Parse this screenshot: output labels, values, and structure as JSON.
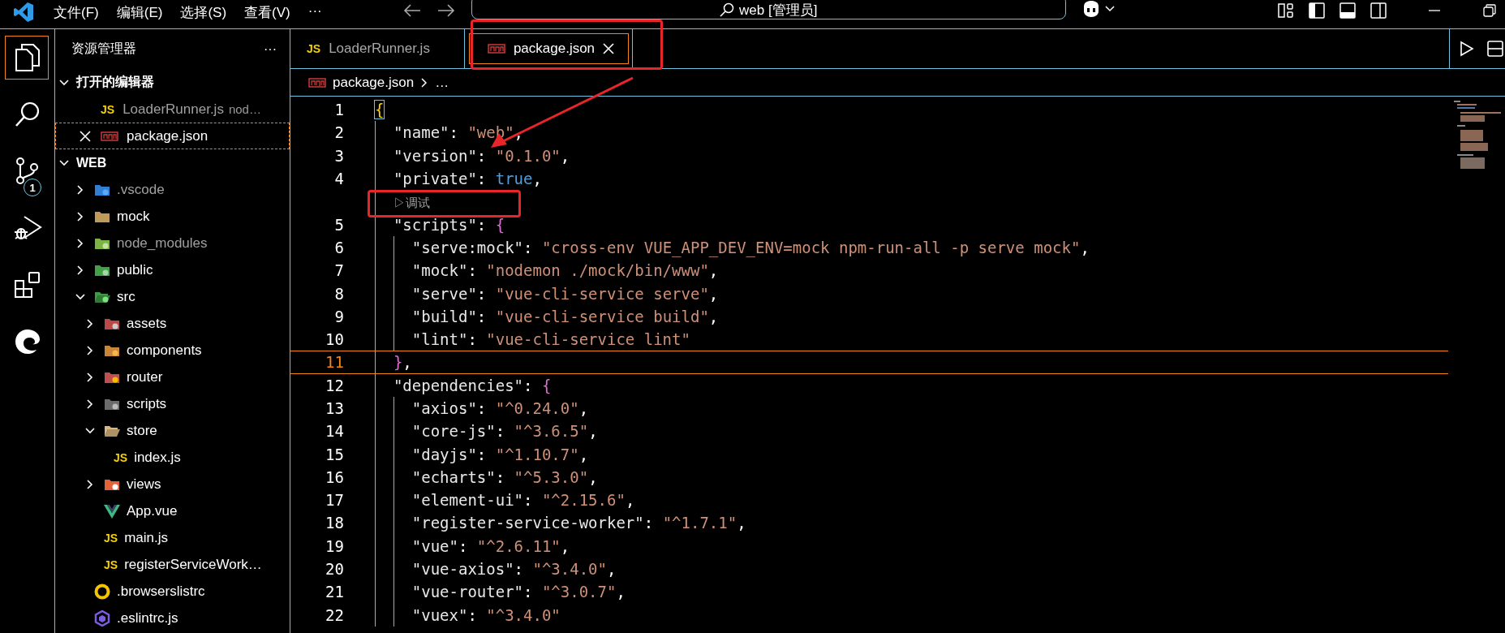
{
  "title_bar": {
    "menus": [
      {
        "label": "文件(F)"
      },
      {
        "label": "编辑(E)"
      },
      {
        "label": "选择(S)"
      },
      {
        "label": "查看(V)"
      }
    ],
    "more": "···",
    "command_center": "web [管理员]"
  },
  "activity_bar": [
    {
      "kind": "explorer",
      "selected": true
    },
    {
      "kind": "search",
      "selected": false
    },
    {
      "kind": "scm",
      "selected": false,
      "badge": "1"
    },
    {
      "kind": "debug",
      "selected": false
    },
    {
      "kind": "extensions",
      "selected": false
    },
    {
      "kind": "browser",
      "selected": false
    }
  ],
  "explorer": {
    "title": "资源管理器",
    "more": "···",
    "open_editors": {
      "title": "打开的编辑器",
      "expanded": true,
      "items": [
        {
          "name": "LoaderRunner.js",
          "description": "nod…",
          "kind": "js",
          "icon_label": "JS",
          "selected": false
        },
        {
          "name": "package.json",
          "kind": "npm",
          "selected": true
        }
      ]
    },
    "folder": {
      "title": "WEB",
      "expanded": true,
      "items": [
        {
          "name": ".vscode",
          "kind": "vscode",
          "expanded": false,
          "dimmed": true
        },
        {
          "name": "mock",
          "kind": "folder",
          "expanded": false,
          "dimmed": false
        },
        {
          "name": "node_modules",
          "kind": "node",
          "expanded": false,
          "dimmed": true
        },
        {
          "name": "public",
          "kind": "public",
          "expanded": false,
          "dimmed": false
        },
        {
          "name": "src",
          "kind": "src",
          "expanded": true,
          "dimmed": false,
          "children": [
            {
              "name": "assets",
              "kind": "assets",
              "expanded": false,
              "dimmed": false
            },
            {
              "name": "components",
              "kind": "components",
              "expanded": false,
              "dimmed": false
            },
            {
              "name": "router",
              "kind": "router",
              "expanded": false,
              "dimmed": false
            },
            {
              "name": "scripts",
              "kind": "scripts",
              "expanded": false,
              "dimmed": false
            },
            {
              "name": "store",
              "kind": "store",
              "expanded": true,
              "dimmed": false,
              "children": [
                {
                  "name": "index.js",
                  "kind": "js",
                  "icon_label": "JS",
                  "dimmed": false
                }
              ]
            },
            {
              "name": "views",
              "kind": "views",
              "expanded": false,
              "dimmed": false
            },
            {
              "name": "App.vue",
              "kind": "vue",
              "dimmed": false
            },
            {
              "name": "main.js",
              "kind": "js",
              "icon_label": "JS",
              "dimmed": false
            },
            {
              "name": "registerServiceWork…",
              "kind": "js",
              "icon_label": "JS",
              "dimmed": false
            }
          ]
        },
        {
          "name": ".browserslistrc",
          "kind": "ring",
          "dimmed": false
        },
        {
          "name": ".eslintrc.js",
          "kind": "hexagon",
          "dimmed": false
        }
      ]
    }
  },
  "editor": {
    "tabs": [
      {
        "label": "LoaderRunner.js",
        "kind": "js",
        "icon_label": "JS",
        "selected": false
      },
      {
        "label": "package.json",
        "kind": "npm",
        "selected": true
      }
    ],
    "breadcrumb": [
      {
        "label": "package.json",
        "kind": "npm"
      },
      {
        "label": "…"
      }
    ],
    "lines": [
      {
        "kind": "code",
        "number": "1",
        "current": false,
        "tokens": [
          {
            "kind": "brace1",
            "text": "{"
          }
        ]
      },
      {
        "kind": "code",
        "number": "2",
        "current": false,
        "tokens": [
          {
            "kind": "key",
            "text": "  \"name\""
          },
          {
            "kind": "punct",
            "text": ": "
          },
          {
            "kind": "string",
            "text": "\"web\""
          },
          {
            "kind": "punct",
            "text": ","
          }
        ]
      },
      {
        "kind": "code",
        "number": "3",
        "current": false,
        "tokens": [
          {
            "kind": "key",
            "text": "  \"version\""
          },
          {
            "kind": "punct",
            "text": ": "
          },
          {
            "kind": "string",
            "text": "\"0.1.0\""
          },
          {
            "kind": "punct",
            "text": ","
          }
        ]
      },
      {
        "kind": "code",
        "number": "4",
        "current": false,
        "tokens": [
          {
            "kind": "key",
            "text": "  \"private\""
          },
          {
            "kind": "punct",
            "text": ": "
          },
          {
            "kind": "bool",
            "text": "true"
          },
          {
            "kind": "punct",
            "text": ","
          }
        ]
      },
      {
        "kind": "codelens",
        "tokens": [
          {
            "kind": "lens",
            "text": "▷调试"
          }
        ]
      },
      {
        "kind": "code",
        "number": "5",
        "current": false,
        "tokens": [
          {
            "kind": "key",
            "text": "  \"scripts\""
          },
          {
            "kind": "punct",
            "text": ": "
          },
          {
            "kind": "brace2",
            "text": "{"
          }
        ]
      },
      {
        "kind": "code",
        "number": "6",
        "current": false,
        "tokens": [
          {
            "kind": "key",
            "text": "    \"serve:mock\""
          },
          {
            "kind": "punct",
            "text": ": "
          },
          {
            "kind": "string",
            "text": "\"cross-env VUE_APP_DEV_ENV=mock npm-run-all -p serve mock\""
          },
          {
            "kind": "punct",
            "text": ","
          }
        ]
      },
      {
        "kind": "code",
        "number": "7",
        "current": false,
        "tokens": [
          {
            "kind": "key",
            "text": "    \"mock\""
          },
          {
            "kind": "punct",
            "text": ": "
          },
          {
            "kind": "string",
            "text": "\"nodemon ./mock/bin/www\""
          },
          {
            "kind": "punct",
            "text": ","
          }
        ]
      },
      {
        "kind": "code",
        "number": "8",
        "current": false,
        "tokens": [
          {
            "kind": "key",
            "text": "    \"serve\""
          },
          {
            "kind": "punct",
            "text": ": "
          },
          {
            "kind": "string",
            "text": "\"vue-cli-service serve\""
          },
          {
            "kind": "punct",
            "text": ","
          }
        ]
      },
      {
        "kind": "code",
        "number": "9",
        "current": false,
        "tokens": [
          {
            "kind": "key",
            "text": "    \"build\""
          },
          {
            "kind": "punct",
            "text": ": "
          },
          {
            "kind": "string",
            "text": "\"vue-cli-service build\""
          },
          {
            "kind": "punct",
            "text": ","
          }
        ]
      },
      {
        "kind": "code",
        "number": "10",
        "current": false,
        "tokens": [
          {
            "kind": "key",
            "text": "    \"lint\""
          },
          {
            "kind": "punct",
            "text": ": "
          },
          {
            "kind": "string",
            "text": "\"vue-cli-service lint\""
          }
        ]
      },
      {
        "kind": "code",
        "number": "11",
        "current": true,
        "tokens": [
          {
            "kind": "brace2",
            "text": "  }"
          },
          {
            "kind": "punct",
            "text": ","
          }
        ]
      },
      {
        "kind": "code",
        "number": "12",
        "current": false,
        "tokens": [
          {
            "kind": "key",
            "text": "  \"dependencies\""
          },
          {
            "kind": "punct",
            "text": ": "
          },
          {
            "kind": "brace2",
            "text": "{"
          }
        ]
      },
      {
        "kind": "code",
        "number": "13",
        "current": false,
        "tokens": [
          {
            "kind": "key",
            "text": "    \"axios\""
          },
          {
            "kind": "punct",
            "text": ": "
          },
          {
            "kind": "string",
            "text": "\"^0.24.0\""
          },
          {
            "kind": "punct",
            "text": ","
          }
        ]
      },
      {
        "kind": "code",
        "number": "14",
        "current": false,
        "tokens": [
          {
            "kind": "key",
            "text": "    \"core-js\""
          },
          {
            "kind": "punct",
            "text": ": "
          },
          {
            "kind": "string",
            "text": "\"^3.6.5\""
          },
          {
            "kind": "punct",
            "text": ","
          }
        ]
      },
      {
        "kind": "code",
        "number": "15",
        "current": false,
        "tokens": [
          {
            "kind": "key",
            "text": "    \"dayjs\""
          },
          {
            "kind": "punct",
            "text": ": "
          },
          {
            "kind": "string",
            "text": "\"^1.10.7\""
          },
          {
            "kind": "punct",
            "text": ","
          }
        ]
      },
      {
        "kind": "code",
        "number": "16",
        "current": false,
        "tokens": [
          {
            "kind": "key",
            "text": "    \"echarts\""
          },
          {
            "kind": "punct",
            "text": ": "
          },
          {
            "kind": "string",
            "text": "\"^5.3.0\""
          },
          {
            "kind": "punct",
            "text": ","
          }
        ]
      },
      {
        "kind": "code",
        "number": "17",
        "current": false,
        "tokens": [
          {
            "kind": "key",
            "text": "    \"element-ui\""
          },
          {
            "kind": "punct",
            "text": ": "
          },
          {
            "kind": "string",
            "text": "\"^2.15.6\""
          },
          {
            "kind": "punct",
            "text": ","
          }
        ]
      },
      {
        "kind": "code",
        "number": "18",
        "current": false,
        "tokens": [
          {
            "kind": "key",
            "text": "    \"register-service-worker\""
          },
          {
            "kind": "punct",
            "text": ": "
          },
          {
            "kind": "string",
            "text": "\"^1.7.1\""
          },
          {
            "kind": "punct",
            "text": ","
          }
        ]
      },
      {
        "kind": "code",
        "number": "19",
        "current": false,
        "tokens": [
          {
            "kind": "key",
            "text": "    \"vue\""
          },
          {
            "kind": "punct",
            "text": ": "
          },
          {
            "kind": "string",
            "text": "\"^2.6.11\""
          },
          {
            "kind": "punct",
            "text": ","
          }
        ]
      },
      {
        "kind": "code",
        "number": "20",
        "current": false,
        "tokens": [
          {
            "kind": "key",
            "text": "    \"vue-axios\""
          },
          {
            "kind": "punct",
            "text": ": "
          },
          {
            "kind": "string",
            "text": "\"^3.4.0\""
          },
          {
            "kind": "punct",
            "text": ","
          }
        ]
      },
      {
        "kind": "code",
        "number": "21",
        "current": false,
        "tokens": [
          {
            "kind": "key",
            "text": "    \"vue-router\""
          },
          {
            "kind": "punct",
            "text": ": "
          },
          {
            "kind": "string",
            "text": "\"^3.0.7\""
          },
          {
            "kind": "punct",
            "text": ","
          }
        ]
      },
      {
        "kind": "code",
        "number": "22",
        "current": false,
        "tokens": [
          {
            "kind": "key",
            "text": "    \"vuex\""
          },
          {
            "kind": "punct",
            "text": ": "
          },
          {
            "kind": "string",
            "text": "\"^3.4.0\""
          }
        ]
      }
    ]
  }
}
